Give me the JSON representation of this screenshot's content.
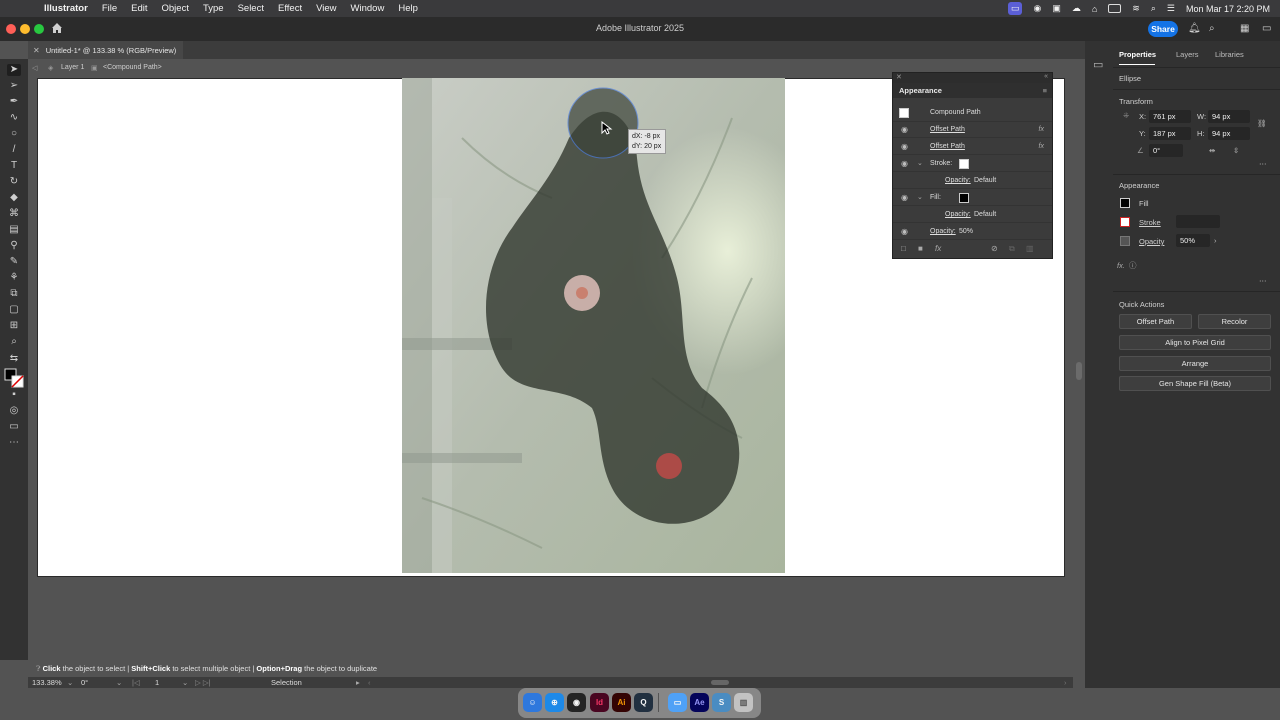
{
  "menubar": {
    "app_name": "Illustrator",
    "menus": [
      "File",
      "Edit",
      "Object",
      "Type",
      "Select",
      "Effect",
      "View",
      "Window",
      "Help"
    ],
    "clock": "Mon Mar 17  2:20 PM"
  },
  "window": {
    "title": "Adobe Illustrator 2025",
    "share_label": "Share"
  },
  "document": {
    "tab_title": "Untitled-1* @ 133.38 % (RGB/Preview)",
    "breadcrumb": [
      "Layer 1",
      "<Compound Path>"
    ]
  },
  "canvas": {
    "measure_dx": "dX: -8 px",
    "measure_dy": "dY: 20 px"
  },
  "appearance": {
    "title": "Appearance",
    "header_label": "Compound Path",
    "rows": [
      {
        "label": "Offset Path",
        "fx": "fx"
      },
      {
        "label": "Offset Path",
        "fx": "fx"
      },
      {
        "label": "Stroke:"
      },
      {
        "label": "Opacity:",
        "value": "Default"
      },
      {
        "label": "Fill:"
      },
      {
        "label": "Opacity:",
        "value": "Default"
      },
      {
        "label": "Opacity:",
        "value": "50%"
      }
    ]
  },
  "properties": {
    "tabs": [
      "Properties",
      "Layers",
      "Libraries"
    ],
    "object_type": "Ellipse",
    "transform": {
      "title": "Transform",
      "x_label": "X:",
      "x": "761 px",
      "y_label": "Y:",
      "y": "187 px",
      "w_label": "W:",
      "w": "94 px",
      "h_label": "H:",
      "h": "94 px",
      "angle": "0°"
    },
    "appearance": {
      "title": "Appearance",
      "fill_label": "Fill",
      "stroke_label": "Stroke",
      "opacity_label": "Opacity",
      "opacity_value": "50%"
    },
    "quick_actions": {
      "title": "Quick Actions",
      "offset_path": "Offset Path",
      "recolor": "Recolor",
      "align_pixel_grid": "Align to Pixel Grid",
      "arrange": "Arrange",
      "gen_shape_fill": "Gen Shape Fill (Beta)"
    }
  },
  "status": {
    "hint_click": "Click",
    "hint_click_text": " the object to select  |  ",
    "hint_shift": "Shift+Click",
    "hint_shift_text": " to select multiple object  |  ",
    "hint_option": "Option+Drag",
    "hint_option_text": " the object to duplicate",
    "zoom": "133.38%",
    "rotation": "0°",
    "artboard_num": "1",
    "tool_name": "Selection"
  },
  "colors": {
    "accent": "#1473e6",
    "panel": "#323232",
    "canvas": "#535353"
  }
}
